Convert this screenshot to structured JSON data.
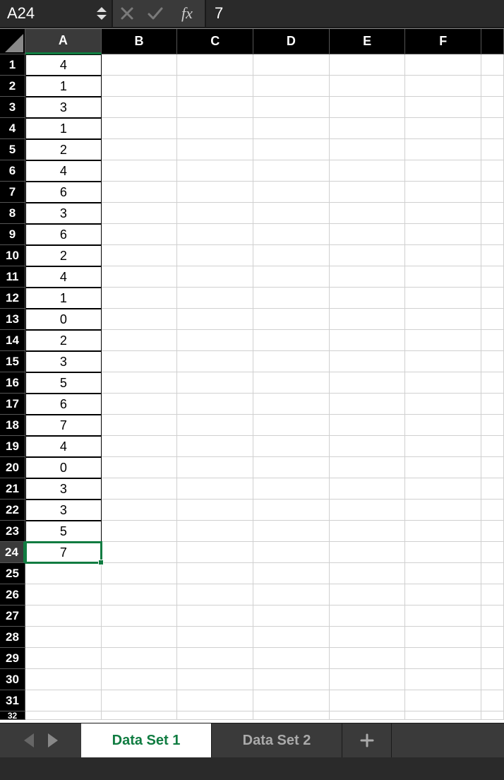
{
  "formula_bar": {
    "cell_ref": "A24",
    "fx_label": "fx",
    "value": "7"
  },
  "columns": [
    "A",
    "B",
    "C",
    "D",
    "E",
    "F",
    ""
  ],
  "selected_column_index": 0,
  "rows": [
    "1",
    "2",
    "3",
    "4",
    "5",
    "6",
    "7",
    "8",
    "9",
    "10",
    "11",
    "12",
    "13",
    "14",
    "15",
    "16",
    "17",
    "18",
    "19",
    "20",
    "21",
    "22",
    "23",
    "24",
    "25",
    "26",
    "27",
    "28",
    "29",
    "30",
    "31"
  ],
  "partial_row_label": "32",
  "selected_row_index": 23,
  "data_col_a": [
    "4",
    "1",
    "3",
    "1",
    "2",
    "4",
    "6",
    "3",
    "6",
    "2",
    "4",
    "1",
    "0",
    "2",
    "3",
    "5",
    "6",
    "7",
    "4",
    "0",
    "3",
    "3",
    "5",
    "7"
  ],
  "active_cell": {
    "row": 23,
    "col": 0,
    "value": "7"
  },
  "sheets": [
    {
      "label": "Data Set 1",
      "active": true
    },
    {
      "label": "Data Set 2",
      "active": false
    }
  ]
}
